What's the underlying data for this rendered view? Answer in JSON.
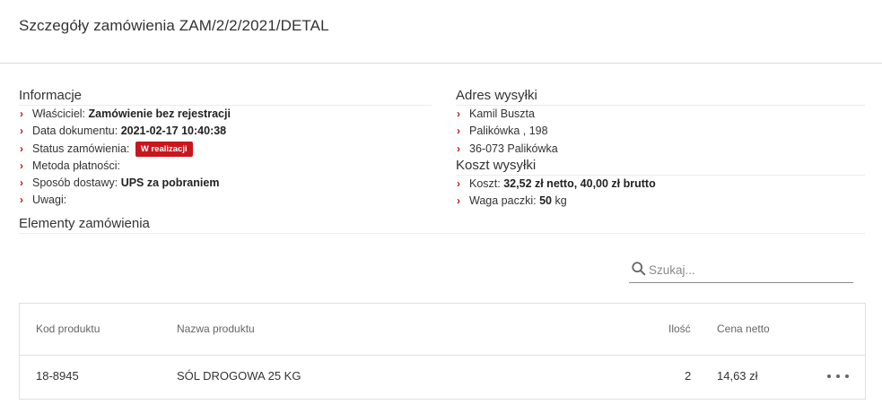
{
  "page": {
    "title": "Szczegóły zamówienia ZAM/2/2/2021/DETAL"
  },
  "info": {
    "heading": "Informacje",
    "owner_label": "Właściciel:",
    "owner_value": "Zamówienie bez rejestracji",
    "date_label": "Data dokumentu:",
    "date_value": "2021-02-17 10:40:38",
    "status_label": "Status zamówienia:",
    "status_value": "W realizacji",
    "payment_label": "Metoda płatności:",
    "delivery_label": "Sposób dostawy:",
    "delivery_value": "UPS za pobraniem",
    "notes_label": "Uwagi:"
  },
  "shipping_address": {
    "heading": "Adres wysyłki",
    "lines": [
      "Kamil Buszta",
      "Palikówka , 198",
      "36-073 Palikówka"
    ]
  },
  "shipping_cost": {
    "heading": "Koszt wysyłki",
    "cost_label": "Koszt:",
    "cost_value": "32,52 zł netto, 40,00 zł brutto",
    "weight_label": "Waga paczki:",
    "weight_value": "50",
    "weight_unit": "kg"
  },
  "elements": {
    "heading": "Elementy zamówienia",
    "search_placeholder": "Szukaj...",
    "columns": {
      "code": "Kod produktu",
      "name": "Nazwa produktu",
      "qty": "Ilość",
      "price": "Cena netto"
    },
    "rows": [
      {
        "code": "18-8945",
        "name": "SÓL DROGOWA 25 KG",
        "qty": "2",
        "price": "14,63 zł"
      }
    ]
  },
  "colors": {
    "accent": "#b3141a",
    "badge_bg": "#c8161d"
  },
  "icons": {
    "bullet": "chevron-right-icon",
    "search": "search-icon",
    "row_menu": "more-horizontal-icon"
  }
}
